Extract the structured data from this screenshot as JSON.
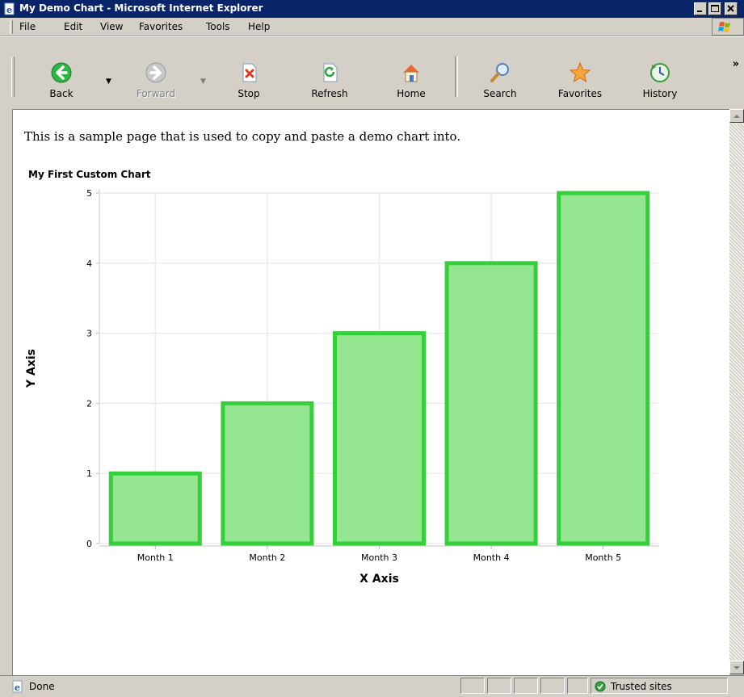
{
  "window": {
    "title": "My Demo Chart - Microsoft Internet Explorer"
  },
  "menu": [
    "File",
    "Edit",
    "View",
    "Favorites",
    "Tools",
    "Help"
  ],
  "toolbar": {
    "back": "Back",
    "forward": "Forward",
    "stop": "Stop",
    "refresh": "Refresh",
    "home": "Home",
    "search": "Search",
    "favorites": "Favorites",
    "history": "History"
  },
  "page": {
    "intro": "This is a sample page that is used to copy and paste a demo chart into."
  },
  "chart_data": {
    "type": "bar",
    "title": "My First Custom Chart",
    "xlabel": "X Axis",
    "ylabel": "Y Axis",
    "categories": [
      "Month 1",
      "Month 2",
      "Month 3",
      "Month 4",
      "Month 5"
    ],
    "values": [
      1,
      2,
      3,
      4,
      5
    ],
    "ylim": [
      0,
      5
    ],
    "yticks": [
      0,
      1,
      2,
      3,
      4,
      5
    ],
    "grid": true,
    "bar_fill": "#94e690",
    "bar_stroke": "#33d03a"
  },
  "status": {
    "text": "Done",
    "zone": "Trusted sites"
  },
  "colors": {
    "titlebar": "#0a246a",
    "chrome": "#d4d0c8"
  },
  "icons": {
    "app": "ie-page-icon",
    "back": "green-left-arrow-icon",
    "forward": "gray-right-arrow-icon",
    "stop": "stop-icon",
    "refresh": "refresh-icon",
    "home": "home-icon",
    "search": "magnifier-icon",
    "favorites": "star-icon",
    "history": "history-icon",
    "zone": "green-check-icon"
  }
}
